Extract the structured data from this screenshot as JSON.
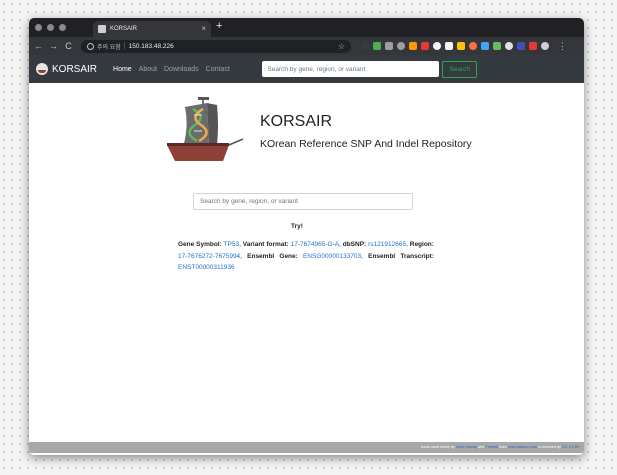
{
  "browser": {
    "tab_title": "KORSAIR",
    "tab_close": "×",
    "new_tab": "+",
    "security_label": "주의 요함",
    "url": "150.183.48.226",
    "nav_back": "←",
    "nav_forward": "→",
    "nav_reload": "C",
    "star_icon": "☆",
    "menu_icon": "⋮",
    "extension_colors": [
      "#3a3b3f",
      "#4caf50",
      "#9e9e9e",
      "#9e9e9e",
      "#ff9800",
      "#e53935",
      "#f5f5f5",
      "#f5f5f5",
      "#ffc107",
      "#ff7043",
      "#42a5f5",
      "#66bb6a",
      "#e0e0e0",
      "#3f51b5",
      "#e53935",
      "#cfcfcf"
    ]
  },
  "navbar": {
    "brand": "KORSAIR",
    "links": [
      "Home",
      "About",
      "Downloads",
      "Contact"
    ],
    "search_placeholder": "Search by gene, region, or variant",
    "search_button": "Search"
  },
  "hero": {
    "title": "KORSAIR",
    "subtitle": "KOrean Reference SNP And Indel Repository"
  },
  "main_search": {
    "placeholder": "Search by gene, region, or variant"
  },
  "examples": {
    "try_label": "Try!",
    "gene_symbol_label": "Gene Symbol:",
    "gene_symbol": "TP53",
    "variant_format_label": "Variant format:",
    "variant_format": "17-7674965-G-A",
    "dbsnp_label": "dbSNP:",
    "dbsnp": "rs121912665",
    "region_label": "Region:",
    "region": "17-7676272-7675994",
    "ensembl_gene_label": "Ensembl Gene:",
    "ensembl_gene": "ENSG00000133703",
    "ensembl_transcript_label": "Ensembl Transcript:",
    "ensembl_transcript": "ENST00000311936"
  },
  "footer": {
    "prefix": "Icons used made by",
    "author1": "Dave Gandy",
    "and": "and",
    "author2": "Freepik",
    "from": "from",
    "site": "www.flaticon.com",
    "licensed": "is licensed by",
    "license": "CC 3.0 BY"
  },
  "colors": {
    "navbar": "#343a40",
    "link": "#1f6fd1",
    "search_button": "#28a745",
    "ship_hull": "#8d3f38",
    "dna_green": "#5cb85c",
    "dna_orange": "#f0ad4e"
  }
}
